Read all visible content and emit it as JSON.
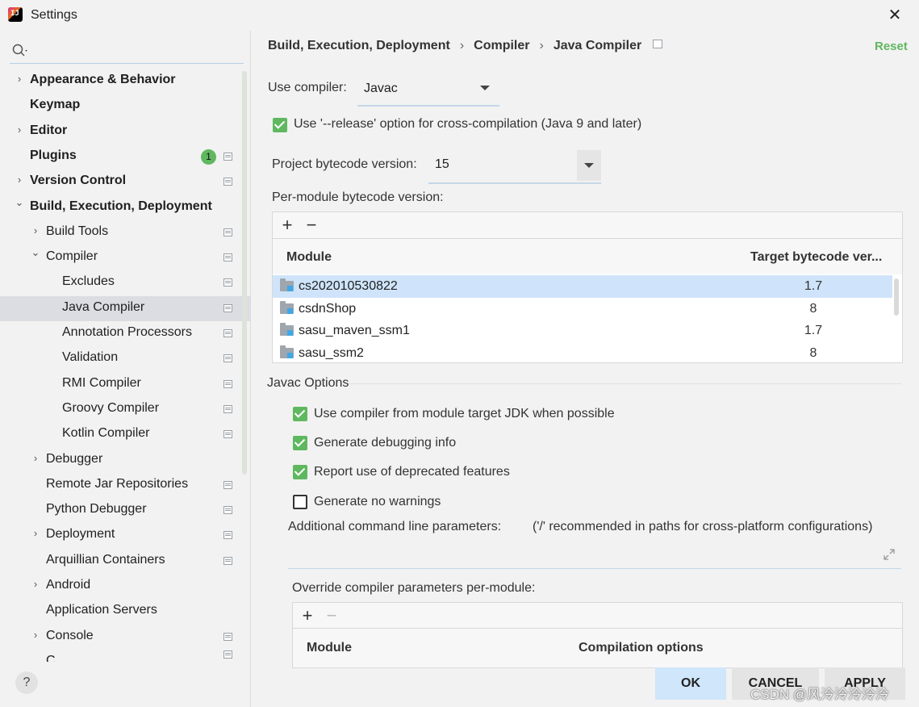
{
  "window": {
    "title": "Settings",
    "close_glyph": "✕"
  },
  "app_icon_text": "IJ",
  "sidebar": {
    "items": [
      {
        "label": "Appearance & Behavior",
        "level": 0,
        "bold": true,
        "chevron": "right",
        "proj": false
      },
      {
        "label": "Keymap",
        "level": 0,
        "bold": true,
        "chevron": "none",
        "proj": false
      },
      {
        "label": "Editor",
        "level": 0,
        "bold": true,
        "chevron": "right",
        "proj": false
      },
      {
        "label": "Plugins",
        "level": 0,
        "bold": true,
        "chevron": "none",
        "proj": true,
        "badge": "1"
      },
      {
        "label": "Version Control",
        "level": 0,
        "bold": true,
        "chevron": "right",
        "proj": true
      },
      {
        "label": "Build, Execution, Deployment",
        "level": 0,
        "bold": true,
        "chevron": "down",
        "proj": false
      },
      {
        "label": "Build Tools",
        "level": 1,
        "bold": false,
        "chevron": "right",
        "proj": true
      },
      {
        "label": "Compiler",
        "level": 1,
        "bold": false,
        "chevron": "down",
        "proj": true
      },
      {
        "label": "Excludes",
        "level": 2,
        "bold": false,
        "chevron": "none",
        "proj": true
      },
      {
        "label": "Java Compiler",
        "level": 2,
        "bold": false,
        "chevron": "none",
        "proj": true,
        "selected": true
      },
      {
        "label": "Annotation Processors",
        "level": 2,
        "bold": false,
        "chevron": "none",
        "proj": true
      },
      {
        "label": "Validation",
        "level": 2,
        "bold": false,
        "chevron": "none",
        "proj": true
      },
      {
        "label": "RMI Compiler",
        "level": 2,
        "bold": false,
        "chevron": "none",
        "proj": true
      },
      {
        "label": "Groovy Compiler",
        "level": 2,
        "bold": false,
        "chevron": "none",
        "proj": true
      },
      {
        "label": "Kotlin Compiler",
        "level": 2,
        "bold": false,
        "chevron": "none",
        "proj": true
      },
      {
        "label": "Debugger",
        "level": 1,
        "bold": false,
        "chevron": "right",
        "proj": false
      },
      {
        "label": "Remote Jar Repositories",
        "level": 1,
        "bold": false,
        "chevron": "none",
        "proj": true
      },
      {
        "label": "Python Debugger",
        "level": 1,
        "bold": false,
        "chevron": "none",
        "proj": true
      },
      {
        "label": "Deployment",
        "level": 1,
        "bold": false,
        "chevron": "right",
        "proj": true
      },
      {
        "label": "Arquillian Containers",
        "level": 1,
        "bold": false,
        "chevron": "none",
        "proj": true
      },
      {
        "label": "Android",
        "level": 1,
        "bold": false,
        "chevron": "right",
        "proj": false
      },
      {
        "label": "Application Servers",
        "level": 1,
        "bold": false,
        "chevron": "none",
        "proj": false
      },
      {
        "label": "Console",
        "level": 1,
        "bold": false,
        "chevron": "right",
        "proj": true
      },
      {
        "label": "C...",
        "level": 1,
        "bold": false,
        "chevron": "none",
        "proj": true,
        "clipped": true
      }
    ],
    "help_label": "?"
  },
  "breadcrumb": [
    "Build, Execution, Deployment",
    "Compiler",
    "Java Compiler"
  ],
  "breadcrumb_sep": "›",
  "reset_label": "Reset",
  "use_compiler": {
    "label": "Use compiler:",
    "value": "Javac"
  },
  "release_option": {
    "label": "Use '--release' option for cross-compilation (Java 9 and later)",
    "checked": true
  },
  "project_bytecode": {
    "label": "Project bytecode version:",
    "value": "15"
  },
  "per_module": {
    "label": "Per-module bytecode version:",
    "add": "+",
    "remove": "−",
    "columns": [
      "Module",
      "Target bytecode ver..."
    ],
    "rows": [
      {
        "module": "cs202010530822",
        "version": "1.7",
        "selected": true
      },
      {
        "module": "csdnShop",
        "version": "8"
      },
      {
        "module": "sasu_maven_ssm1",
        "version": "1.7"
      },
      {
        "module": "sasu_ssm2",
        "version": "8"
      }
    ]
  },
  "javac_options": {
    "title": "Javac Options",
    "checkboxes": [
      {
        "label": "Use compiler from module target JDK when possible",
        "checked": true
      },
      {
        "label": "Generate debugging info",
        "checked": true
      },
      {
        "label": "Report use of deprecated features",
        "checked": true
      },
      {
        "label": "Generate no warnings",
        "checked": false
      }
    ],
    "additional_label": "Additional command line parameters:",
    "additional_hint": "('/' recommended in paths for cross-platform configurations)"
  },
  "override": {
    "label": "Override compiler parameters per-module:",
    "add": "+",
    "remove": "−",
    "columns": [
      "Module",
      "Compilation options"
    ]
  },
  "buttons": {
    "ok": "OK",
    "cancel": "CANCEL",
    "apply": "APPLY"
  },
  "watermark": "CSDN @风泠泠泠泠泠",
  "colors": {
    "accent_green": "#5fb85f",
    "selection_blue": "#cfe4fa",
    "ok_button": "#cfe6fb"
  }
}
